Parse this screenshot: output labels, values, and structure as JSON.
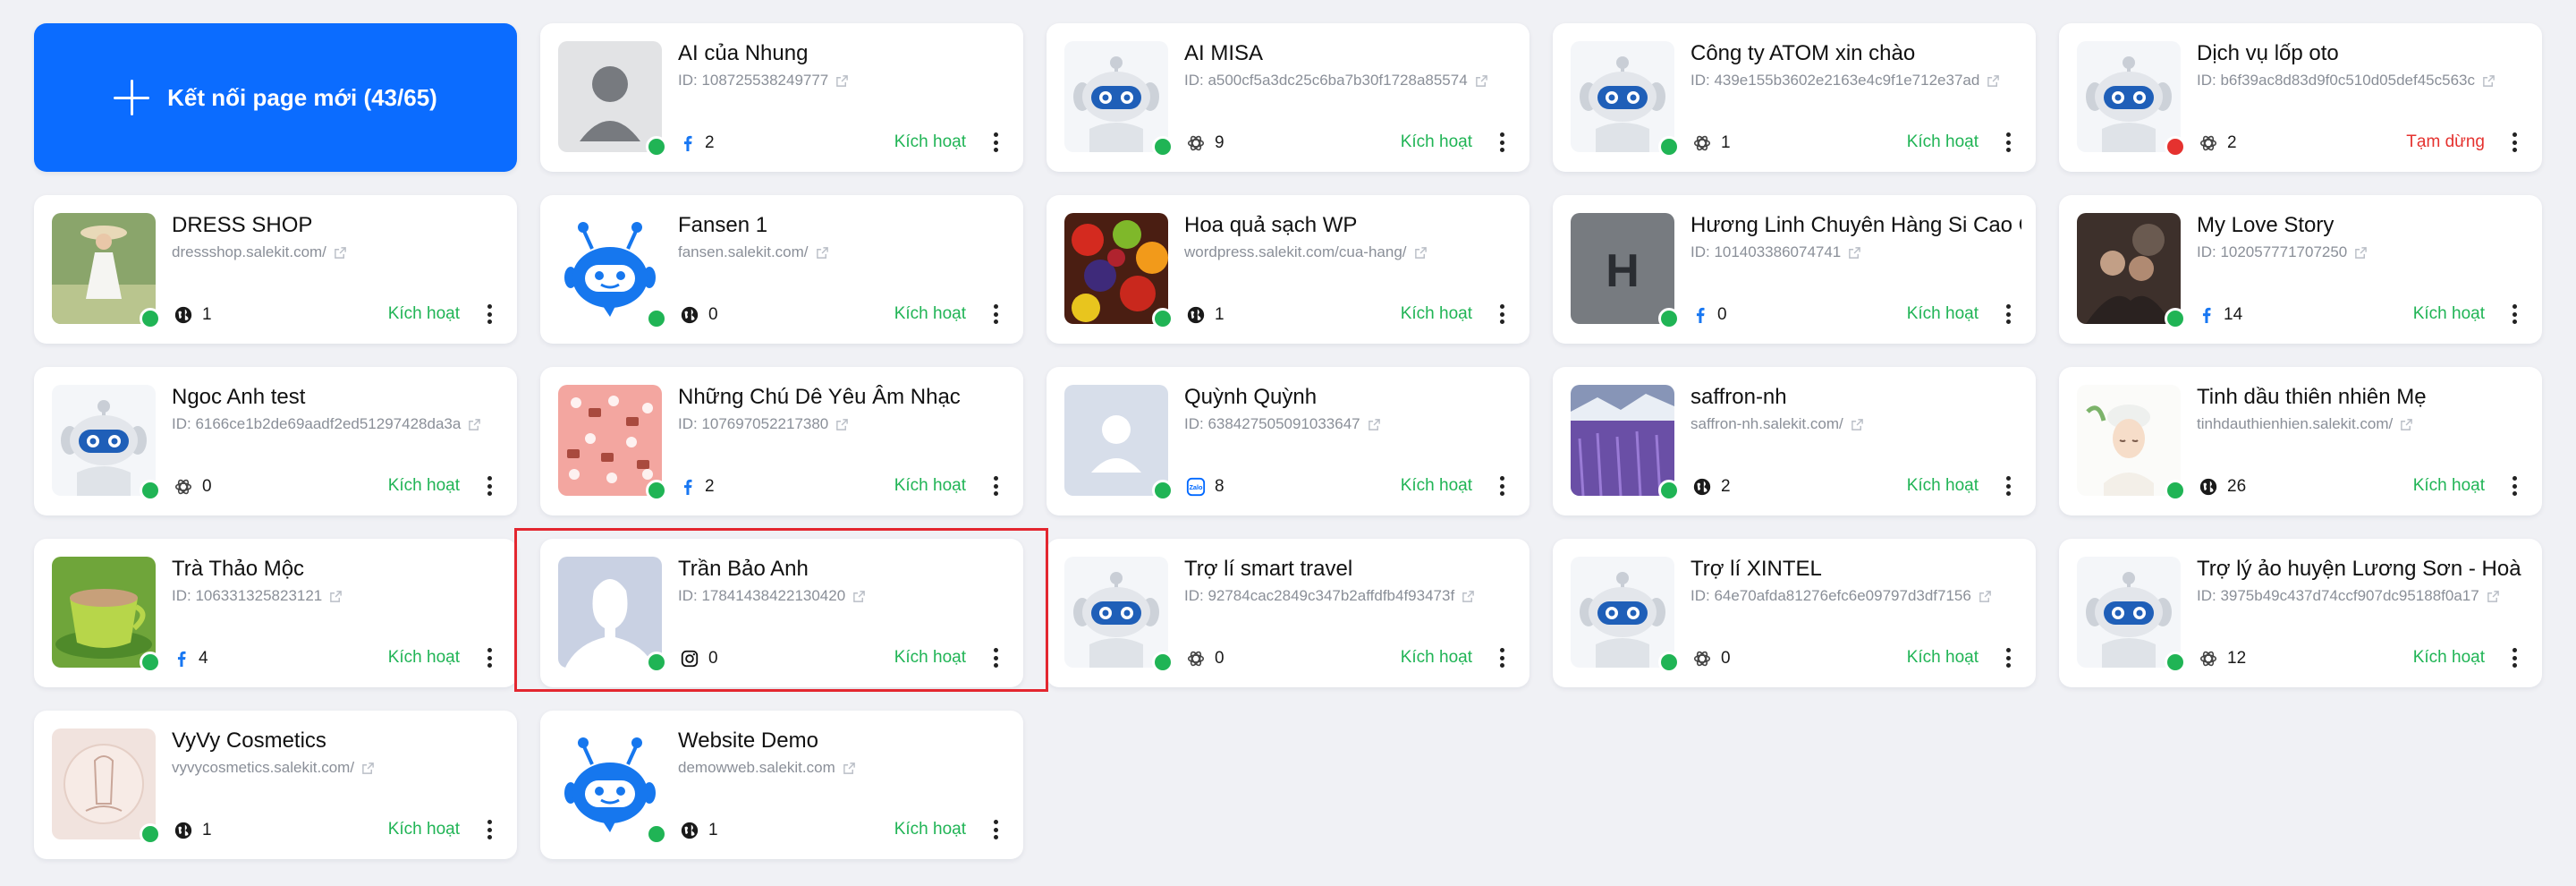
{
  "colors": {
    "primary": "#0b6cff",
    "active": "#20b455",
    "paused": "#e5322f",
    "highlight": "#e3262f"
  },
  "connect_button": {
    "label": "Kết nối page mới (43/65)"
  },
  "pages": [
    {
      "name": "AI của Nhung",
      "sub": "ID: 108725538249777",
      "platform": "facebook",
      "count": "2",
      "status": "Kích hoạt",
      "state": "active",
      "avatar": "person"
    },
    {
      "name": "AI MISA",
      "sub": "ID: a500cf5a3dc25c6ba7b30f1728a85574",
      "platform": "openai",
      "count": "9",
      "status": "Kích hoạt",
      "state": "active",
      "avatar": "robot"
    },
    {
      "name": "Công ty ATOM xin chào",
      "sub": "ID: 439e155b3602e2163e4c9f1e712e37ad",
      "platform": "openai",
      "count": "1",
      "status": "Kích hoạt",
      "state": "active",
      "avatar": "robot"
    },
    {
      "name": "Dịch vụ lốp oto",
      "sub": "ID: b6f39ac8d83d9f0c510d05def45c563c",
      "platform": "openai",
      "count": "2",
      "status": "Tạm dừng",
      "state": "paused",
      "avatar": "robot"
    },
    {
      "name": "DRESS SHOP",
      "sub": "dressshop.salekit.com/",
      "platform": "web",
      "count": "1",
      "status": "Kích hoạt",
      "state": "active",
      "avatar": "dress"
    },
    {
      "name": "Fansen 1",
      "sub": "fansen.salekit.com/",
      "platform": "web",
      "count": "0",
      "status": "Kích hoạt",
      "state": "active",
      "avatar": "bot-blue"
    },
    {
      "name": "Hoa quả sạch WP",
      "sub": "wordpress.salekit.com/cua-hang/",
      "platform": "web",
      "count": "1",
      "status": "Kích hoạt",
      "state": "active",
      "avatar": "fruit"
    },
    {
      "name": "Hương Linh Chuyên Hàng Si Cao Cấp",
      "sub": "ID: 101403386074741",
      "platform": "facebook",
      "count": "0",
      "status": "Kích hoạt",
      "state": "active",
      "avatar": "letter-h"
    },
    {
      "name": "My Love Story",
      "sub": "ID: 102057771707250",
      "platform": "facebook",
      "count": "14",
      "status": "Kích hoạt",
      "state": "active",
      "avatar": "love"
    },
    {
      "name": "Ngoc Anh test",
      "sub": "ID: 6166ce1b2de69aadf2ed51297428da3a",
      "platform": "openai",
      "count": "0",
      "status": "Kích hoạt",
      "state": "active",
      "avatar": "robot"
    },
    {
      "name": "Những Chú Dê Yêu Âm Nhạc",
      "sub": "ID: 107697052217380",
      "platform": "facebook",
      "count": "2",
      "status": "Kích hoạt",
      "state": "active",
      "avatar": "pattern"
    },
    {
      "name": "Quỳnh Quỳnh",
      "sub": "ID: 638427505091033647",
      "platform": "zalo",
      "count": "8",
      "status": "Kích hoạt",
      "state": "active",
      "avatar": "person-light"
    },
    {
      "name": "saffron-nh",
      "sub": "saffron-nh.salekit.com/",
      "platform": "web",
      "count": "2",
      "status": "Kích hoạt",
      "state": "active",
      "avatar": "lavender"
    },
    {
      "name": "Tinh dầu thiên nhiên Mẹ",
      "sub": "tinhdauthienhien.salekit.com/",
      "platform": "web",
      "count": "26",
      "status": "Kích hoạt",
      "state": "active",
      "avatar": "face"
    },
    {
      "name": "Trà Thảo Mộc",
      "sub": "ID: 106331325823121",
      "platform": "facebook",
      "count": "4",
      "status": "Kích hoạt",
      "state": "active",
      "avatar": "tea"
    },
    {
      "name": "Trần Bảo Anh",
      "sub": "ID: 17841438422130420",
      "platform": "instagram",
      "count": "0",
      "status": "Kích hoạt",
      "state": "active",
      "avatar": "silhouette"
    },
    {
      "name": "Trợ lí smart travel",
      "sub": "ID: 92784cac2849c347b2affdfb4f93473f",
      "platform": "openai",
      "count": "0",
      "status": "Kích hoạt",
      "state": "active",
      "avatar": "robot"
    },
    {
      "name": "Trợ lí XINTEL",
      "sub": "ID: 64e70afda81276efc6e09797d3df7156",
      "platform": "openai",
      "count": "0",
      "status": "Kích hoạt",
      "state": "active",
      "avatar": "robot"
    },
    {
      "name": "Trợ lý ảo huyện Lương Sơn - Hoà Bình",
      "sub": "ID: 3975b49c437d74ccf907dc95188f0a17",
      "platform": "openai",
      "count": "12",
      "status": "Kích hoạt",
      "state": "active",
      "avatar": "robot"
    },
    {
      "name": "VyVy Cosmetics",
      "sub": "vyvycosmetics.salekit.com/",
      "platform": "web",
      "count": "1",
      "status": "Kích hoạt",
      "state": "active",
      "avatar": "cosmetic"
    },
    {
      "name": "Website Demo",
      "sub": "demowweb.salekit.com",
      "platform": "web",
      "count": "1",
      "status": "Kích hoạt",
      "state": "active",
      "avatar": "bot-blue"
    }
  ]
}
